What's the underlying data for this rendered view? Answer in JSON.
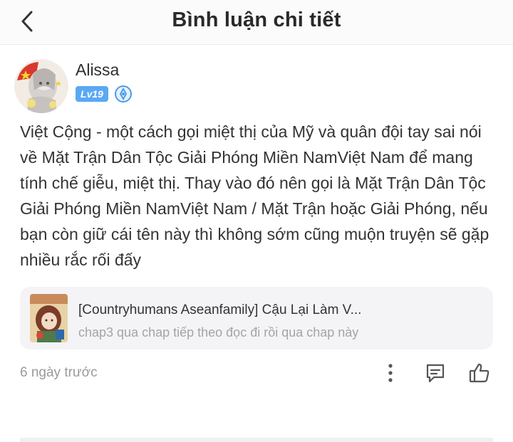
{
  "header": {
    "title": "Bình luận chi tiết",
    "back_icon": "chevron-left-icon"
  },
  "comment": {
    "username": "Alissa",
    "level": "Lv19",
    "verify_icon": "verified-badge-icon",
    "text": "Việt Cộng - một cách gọi miệt thị của Mỹ và quân đội tay sai nói về Mặt Trận Dân Tộc Giải Phóng Miền NamViệt Nam để mang tính chế giễu, miệt thị. Thay vào đó nên gọi là Mặt Trận Dân Tộc Giải Phóng Miền NamViệt Nam / Mặt Trận hoặc Giải Phóng, nếu bạn còn giữ cái tên này thì không sớm cũng muộn truyện sẽ gặp nhiều rắc rối đấy",
    "story": {
      "title": "[Countryhumans Aseanfamily] Cậu Lại Làm V...",
      "subtitle": "chap3 qua chap tiếp theo đọc đi rồi qua chap này"
    },
    "timestamp": "6 ngày trước",
    "actions": {
      "more_icon": "more-vertical-icon",
      "reply_icon": "comment-icon",
      "like_icon": "thumbs-up-icon"
    }
  },
  "colors": {
    "level_badge": "#5aa8f5",
    "card_background": "#f4f4f6",
    "muted_text": "#9a9a9a"
  }
}
